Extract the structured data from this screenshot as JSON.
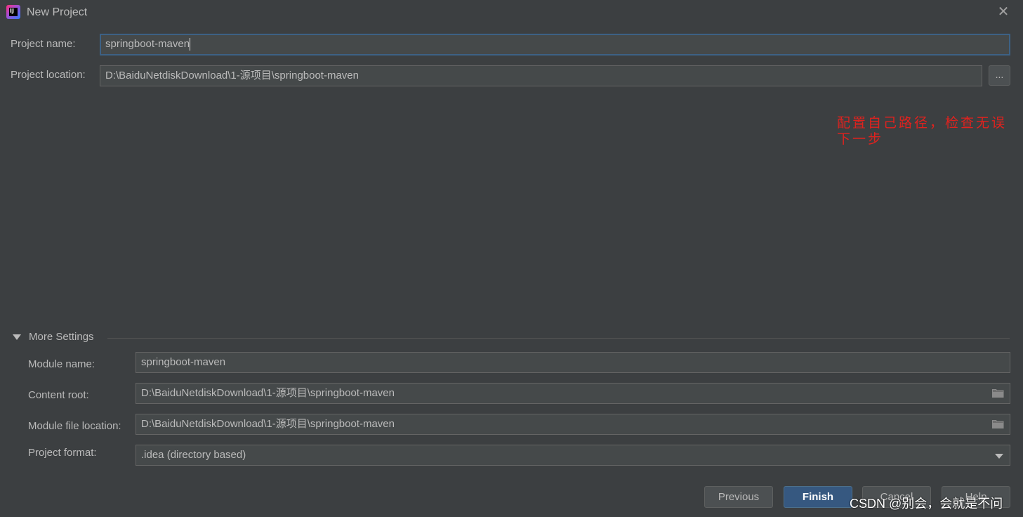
{
  "window": {
    "title": "New Project",
    "app_icon_text": "IJ"
  },
  "form": {
    "project_name_label": "Project name:",
    "project_name_value": "springboot-maven",
    "project_location_label": "Project location:",
    "project_location_value": "D:\\BaiduNetdiskDownload\\1-源项目\\springboot-maven",
    "browse_label": "..."
  },
  "annotation": {
    "line1": "配置自己路径，检查无误",
    "line2": "下一步",
    "color": "#e0221e"
  },
  "more_settings": {
    "label": "More Settings",
    "module_name_label": "Module name:",
    "module_name_value": "springboot-maven",
    "content_root_label": "Content root:",
    "content_root_value": "D:\\BaiduNetdiskDownload\\1-源项目\\springboot-maven",
    "module_file_label": "Module file location:",
    "module_file_value": "D:\\BaiduNetdiskDownload\\1-源项目\\springboot-maven",
    "project_format_label": "Project format:",
    "project_format_value": ".idea (directory based)"
  },
  "footer": {
    "previous_label": "Previous",
    "finish_label": "Finish",
    "cancel_label": "Cancel",
    "help_label": "Help"
  },
  "watermark": {
    "text": "CSDN @别会，会就是不问"
  },
  "colors": {
    "background": "#3c3f41",
    "field": "#45494a",
    "focus_border": "#3d6185",
    "primary_button": "#365880"
  }
}
